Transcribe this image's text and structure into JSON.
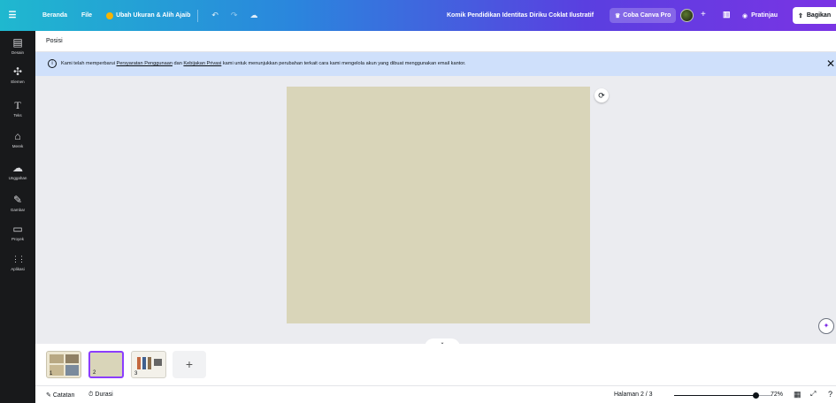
{
  "topbar": {
    "menu_icon": "hamburger-icon",
    "home": "Beranda",
    "file": "File",
    "resize": "Ubah Ukuran & Alih Ajaib",
    "doc_title": "Komik Pendidikan Identitas Diriku Coklat Ilustratif",
    "try_pro": "Coba Canva Pro",
    "preview": "Pratinjau",
    "share": "Bagikan"
  },
  "sidebar": {
    "items": [
      {
        "label": "Desain",
        "icon": "layout-icon",
        "glyph": "▤"
      },
      {
        "label": "Elemen",
        "icon": "shapes-icon",
        "glyph": "✣"
      },
      {
        "label": "Teks",
        "icon": "text-icon",
        "glyph": "T"
      },
      {
        "label": "Merek",
        "icon": "brand-icon",
        "glyph": "⌂"
      },
      {
        "label": "Unggahan",
        "icon": "upload-icon",
        "glyph": "☁"
      },
      {
        "label": "Gambar",
        "icon": "draw-icon",
        "glyph": "✎"
      },
      {
        "label": "Proyek",
        "icon": "folder-icon",
        "glyph": "▭"
      },
      {
        "label": "Aplikasi",
        "icon": "apps-icon",
        "glyph": "⋮⋮"
      }
    ]
  },
  "position_bar": {
    "label": "Posisi"
  },
  "notice": {
    "text_before": "Kami telah memperbarui ",
    "link_terms": "Persyaratan Penggunaan",
    "text_and": " dan ",
    "link_privacy": "Kebijakan Privasi",
    "text_after": " kami untuk menunjukkan perubahan terkait cara kami mengelola akun yang dibuat menggunakan email kantor."
  },
  "pages": [
    {
      "number": "1"
    },
    {
      "number": "2",
      "selected": true
    },
    {
      "number": "3"
    }
  ],
  "footer": {
    "notes": "Catatan",
    "duration": "Durasi",
    "page_indicator": "Halaman 2 / 3",
    "zoom": "72%",
    "zoom_fraction": 0.72
  },
  "colors": {
    "canvas_page": "#d9d5b9",
    "selected_border": "#8b3dff",
    "notice_bg": "#cfe0fb",
    "sidebar_bg": "#18191b"
  }
}
